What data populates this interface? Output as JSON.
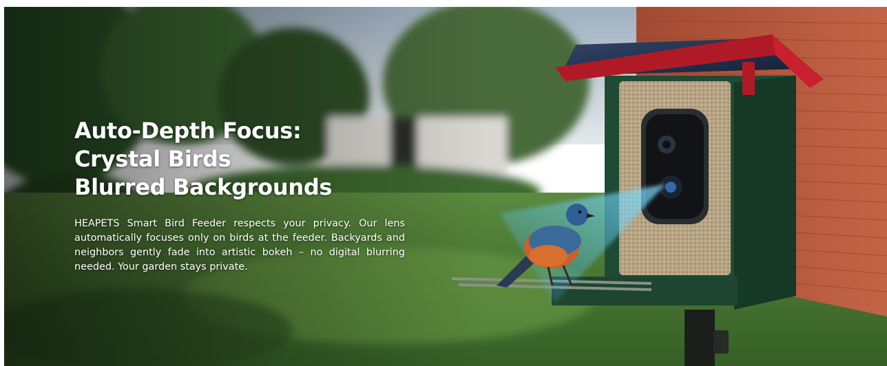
{
  "banner": {
    "headline": [
      "Auto-Depth Focus:",
      "Crystal Birds",
      "Blurred Backgrounds"
    ],
    "body": "HEAPETS Smart Bird Feeder respects your privacy. Our lens automatically focuses only on birds at the feeder. Backyards and neighbors gently fade into artistic bokeh – no digital blurring needed. Your garden stays private."
  },
  "colors": {
    "feeder_body": "#1f4a33",
    "roof": "#c8202e",
    "solar_panel": "#233250",
    "brick": "#b5553a",
    "lawn": "#4a7a36",
    "text": "#ffffff"
  }
}
